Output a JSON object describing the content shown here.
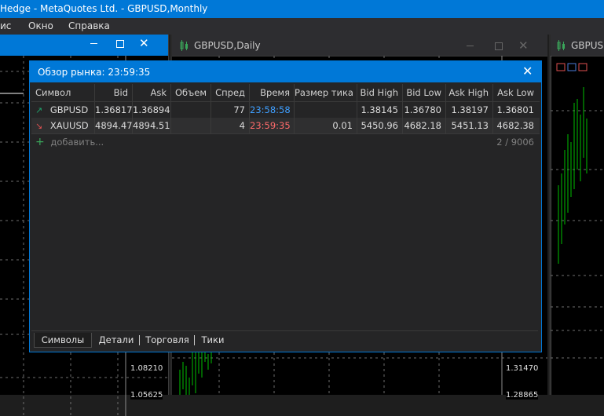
{
  "window": {
    "title": "Hedge - MetaQuotes Ltd. - GBPUSD,Monthly"
  },
  "menu": [
    "ис",
    "Окно",
    "Справка"
  ],
  "charts": {
    "left": {
      "prices": [
        "1.08210",
        "1.05625"
      ]
    },
    "middle": {
      "title": "GBPUSD,Daily",
      "prices": [
        "1.31470",
        "1.28865"
      ]
    },
    "right": {
      "title": "GBPUSD"
    }
  },
  "market_watch": {
    "title": "Обзор рынка: 23:59:35",
    "columns": [
      "Символ",
      "Bid",
      "Ask",
      "Объем",
      "Спред",
      "Время",
      "Размер тика",
      "Bid High",
      "Bid Low",
      "Ask High",
      "Ask Low"
    ],
    "rows": [
      {
        "direction": "up",
        "symbol": "GBPUSD",
        "bid": "1.36817",
        "ask": "1.36894",
        "volume": "",
        "spread": "77",
        "time": "23:58:58",
        "time_color": "#3f9fff",
        "tick_size": "",
        "bid_high": "1.38145",
        "bid_low": "1.36780",
        "ask_high": "1.38197",
        "ask_low": "1.36801"
      },
      {
        "direction": "down",
        "symbol": "XAUUSD",
        "bid": "4894.47",
        "ask": "4894.51",
        "volume": "",
        "spread": "4",
        "time": "23:59:35",
        "time_color": "#ff6b6b",
        "tick_size": "0.01",
        "bid_high": "5450.96",
        "bid_low": "4682.18",
        "ask_high": "5451.13",
        "ask_low": "4682.38"
      }
    ],
    "add_label": "добавить...",
    "count": "2 / 9006",
    "tabs": [
      "Символы",
      "Детали",
      "Торговля",
      "Тики"
    ],
    "active_tab": "Символы"
  },
  "colors": {
    "accent": "#0078d7",
    "up": "#1fa06a",
    "down": "#e05050",
    "candles": "#00c000"
  }
}
